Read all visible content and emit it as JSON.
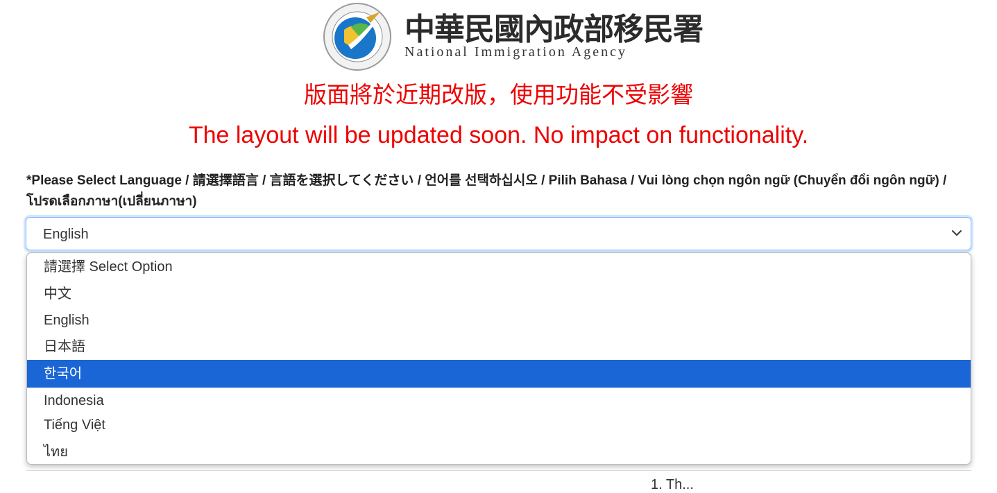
{
  "header": {
    "agency_name_zh": "中華民國內政部移民署",
    "agency_name_en": "National Immigration Agency",
    "seal_text": "National Immigration Agency"
  },
  "notice": {
    "zh": "版面將於近期改版，使用功能不受影響",
    "en": "The layout will be updated soon. No impact on functionality."
  },
  "language": {
    "label": "*Please Select Language / 請選擇語言 / 言語を選択してください / 언어를 선택하십시오 / Pilih Bahasa / Vui lòng chọn ngôn ngữ (Chuyển đổi ngôn ngữ) / โปรดเลือกภาษา(เปลี่ยนภาษา)",
    "selected": "English",
    "options": [
      {
        "label": "請選擇 Select Option",
        "highlighted": false
      },
      {
        "label": "中文",
        "highlighted": false
      },
      {
        "label": "English",
        "highlighted": false
      },
      {
        "label": "日本語",
        "highlighted": false
      },
      {
        "label": "한국어",
        "highlighted": true
      },
      {
        "label": "Indonesia",
        "highlighted": false
      },
      {
        "label": "Tiếng Việt",
        "highlighted": false
      },
      {
        "label": "ไทย",
        "highlighted": false
      }
    ]
  },
  "colors": {
    "notice": "#ee0000",
    "highlight": "#1a66d6",
    "focus_border": "#86b7fe"
  },
  "partial_text": "1. Th..."
}
